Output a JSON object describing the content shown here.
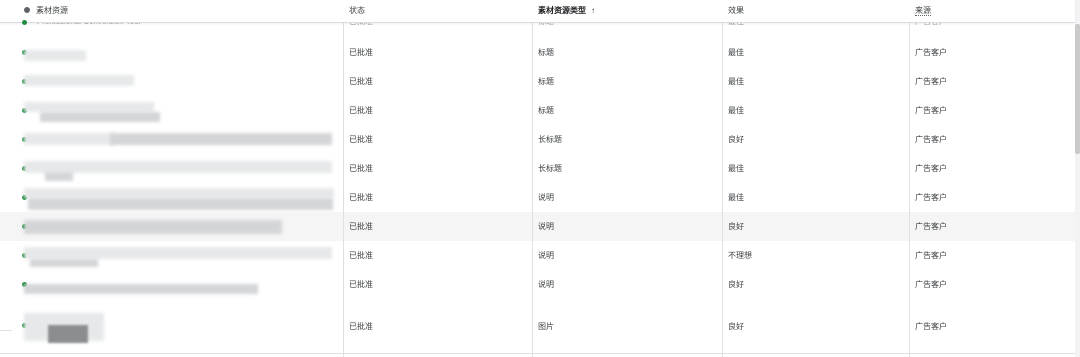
{
  "header": {
    "asset": "素材资源",
    "status": "状态",
    "asset_type": "素材资源类型",
    "sort_arrow": "↑",
    "performance": "效果",
    "source": "来源"
  },
  "peek_row": {
    "asset": "Professional Conversion Tool",
    "status": "已批准",
    "asset_type": "标题",
    "performance": "最佳",
    "source": "广告客户"
  },
  "rows": [
    {
      "status": "已批准",
      "asset_type": "标题",
      "performance": "最佳",
      "source": "广告客户"
    },
    {
      "status": "已批准",
      "asset_type": "标题",
      "performance": "最佳",
      "source": "广告客户"
    },
    {
      "status": "已批准",
      "asset_type": "标题",
      "performance": "最佳",
      "source": "广告客户"
    },
    {
      "status": "已批准",
      "asset_type": "长标题",
      "performance": "良好",
      "source": "广告客户"
    },
    {
      "status": "已批准",
      "asset_type": "长标题",
      "performance": "最佳",
      "source": "广告客户"
    },
    {
      "status": "已批准",
      "asset_type": "说明",
      "performance": "最佳",
      "source": "广告客户"
    },
    {
      "status": "已批准",
      "asset_type": "说明",
      "performance": "良好",
      "source": "广告客户"
    },
    {
      "status": "已批准",
      "asset_type": "说明",
      "performance": "不理想",
      "source": "广告客户"
    },
    {
      "status": "已批准",
      "asset_type": "说明",
      "performance": "良好",
      "source": "广告客户"
    },
    {
      "status": "已批准",
      "asset_type": "图片",
      "performance": "良好",
      "source": "广告客户"
    }
  ],
  "colors": {
    "status_dot": "#1e8e3e",
    "highlight_row": "#f5f5f5"
  }
}
